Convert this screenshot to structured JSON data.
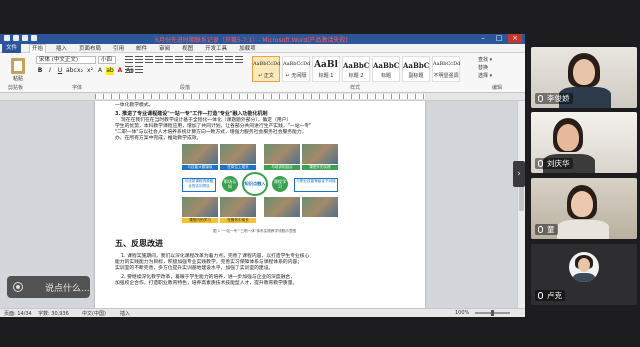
{
  "word": {
    "title": "6月份先进时期联系记录（开篇5-7.1）- Microsoft Word(产品激活失败)",
    "tabs": [
      "文件",
      "开始",
      "插入",
      "页面布局",
      "引用",
      "邮件",
      "审阅",
      "视图",
      "开发工具",
      "加载项"
    ],
    "active_tab": "开始",
    "paste_label": "粘贴",
    "font_name": "宋体 (中文正文)",
    "font_size": "小四",
    "format_buttons": [
      "B",
      "I",
      "U",
      "abc",
      "x₂",
      "x²",
      "A",
      "ab",
      "A",
      "Aa"
    ],
    "group_labels": [
      "剪贴板",
      "字体",
      "段落",
      "样式",
      "编辑"
    ],
    "styles": [
      {
        "sample": "AaBbCcDd",
        "name": "↵ 正文",
        "size": "small",
        "selected": true
      },
      {
        "sample": "AaBbCcDd",
        "name": "↵ 无间隔",
        "size": "small",
        "selected": false
      },
      {
        "sample": "AaBl",
        "name": "标题 1",
        "size": "big",
        "selected": false
      },
      {
        "sample": "AaBbC",
        "name": "标题 2",
        "size": "mid",
        "selected": false
      },
      {
        "sample": "AaBbC",
        "name": "标题",
        "size": "mid",
        "selected": false
      },
      {
        "sample": "AaBbC",
        "name": "副标题",
        "size": "mid",
        "selected": false
      },
      {
        "sample": "AaBbCcDd",
        "name": "不明显强调",
        "size": "small",
        "selected": false
      }
    ],
    "edit_items": [
      "查找 ▾",
      "替换",
      "选择 ▾"
    ],
    "status": {
      "page": "页面: 14/34",
      "words": "字数: 30,936",
      "lang": "中文(中国)",
      "mode": "插入",
      "zoom": "100%"
    }
  },
  "document": {
    "line_top": "一体化教学模式。",
    "subheading": "3. 推进了专业课程建设\"一站一专\"工作—打造\"专业\"融入功能化机制",
    "para_lines": [
      "现在在我们在在当时教学设计基于全程化一体化（课题题外部分），确定（用户）",
      "学生的优势，本科教学课程应用，增加了共同计划，让各部分共同进行生产实践，\"一站一专\"",
      "\"二职一体\"与以社会人才培养系统计算方向一致方式，增强力服务社会服务社会服务能力，",
      "办。在所有方案中完成，推动教学成效。"
    ],
    "diagram": {
      "photo_labels": [
        "与技能大赛接轨",
        "在岗位上成长",
        "与培训相结合",
        "课堂外的实践",
        "课堂内的学习",
        "在服务中成长"
      ],
      "center_label": "知识点融入",
      "left_circle": "职场认知",
      "right_circle": "课程学习",
      "left_box": "与优质课程资源融合的实训项目",
      "right_box": "与职业技能等级证书对接",
      "caption": "图 1 \"一站一专\"\"三职一体\"体系实践教学流程示意图"
    },
    "section_heading": "五、反思改进",
    "section_lines": [
      "1. 课程实施期间，我们以深化课程改革为着力点，完善了课程内容，以打造学生专业核心",
      "能力的实践能力为目标，积极加强专业实践教学，完善实习保障体系与课程体系的内容；",
      "实训室的不断完善，多方位提升实训基地建设水平，加强了实训室的建设。",
      "2. 要继续深化教学改革，着眼于学生能力的培养，进一步加强与企业的深度融合，",
      "加强校企合作，打造职业教育特色，培养高素质技术技能型人才，提升教育教学质量。"
    ]
  },
  "chat_input": {
    "placeholder": "说点什么..."
  },
  "collapse_icon": "chevron-right-icon",
  "participants": [
    {
      "name": "李俊娇",
      "muted": false
    },
    {
      "name": "刘庆华",
      "muted": false
    },
    {
      "name": "童",
      "muted": false
    },
    {
      "name": "卢克",
      "muted": false
    }
  ],
  "colors": {
    "word_blue": "#2b579a",
    "active_speaker": "#1fa850",
    "diagram_blue": "#1f73c2",
    "diagram_yellow": "#f2c230",
    "diagram_green": "#3aa14e"
  }
}
